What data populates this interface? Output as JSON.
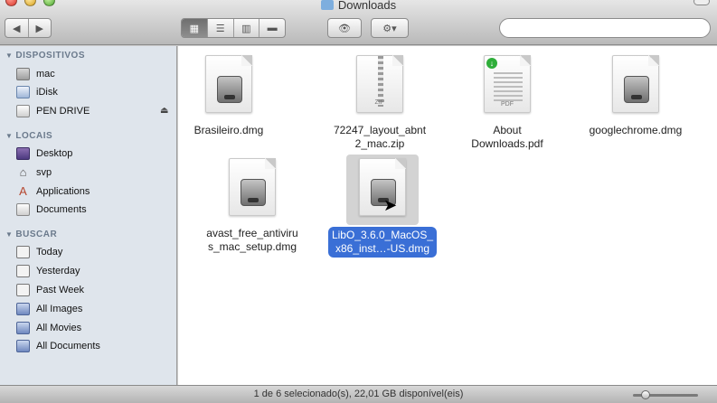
{
  "window": {
    "title": "Downloads"
  },
  "toolbar": {
    "back_glyph": "◀",
    "forward_glyph": "▶",
    "view_icon_glyph": "▦",
    "view_list_glyph": "☰",
    "view_column_glyph": "▥",
    "view_coverflow_glyph": "▬",
    "quicklook_glyph": "👁",
    "action_glyph": "⚙▾",
    "search_value": "",
    "search_glyph": "⌕"
  },
  "sidebar": {
    "devices_header": "DISPOSITIVOS",
    "places_header": "LOCAIS",
    "search_header": "BUSCAR",
    "devices": [
      {
        "label": "mac",
        "icon": "hard-disk-icon"
      },
      {
        "label": "iDisk",
        "icon": "idisk-icon"
      },
      {
        "label": "PEN DRIVE",
        "icon": "usb-drive-icon"
      }
    ],
    "eject_glyph": "⏏",
    "places": [
      {
        "label": "Desktop",
        "icon": "desktop-icon"
      },
      {
        "label": "svp",
        "icon": "home-icon",
        "glyph": "⌂"
      },
      {
        "label": "Applications",
        "icon": "applications-icon",
        "glyph": "A"
      },
      {
        "label": "Documents",
        "icon": "documents-icon"
      }
    ],
    "searches": [
      {
        "label": "Today",
        "icon": "clock-icon"
      },
      {
        "label": "Yesterday",
        "icon": "clock-icon"
      },
      {
        "label": "Past Week",
        "icon": "clock-icon"
      },
      {
        "label": "All Images",
        "icon": "smart-folder-icon"
      },
      {
        "label": "All Movies",
        "icon": "smart-folder-icon"
      },
      {
        "label": "All Documents",
        "icon": "smart-folder-icon"
      }
    ]
  },
  "files": [
    {
      "name": "Brasileiro.dmg",
      "kind": "dmg"
    },
    {
      "name": "72247_layout_abnt2_mac.zip",
      "kind": "zip",
      "badge": "ZIP"
    },
    {
      "name": "About Downloads.pdf",
      "kind": "pdf",
      "badge": "PDF"
    },
    {
      "name": "googlechrome.dmg",
      "kind": "dmg"
    },
    {
      "name": "avast_free_antivirus_mac_setup.dmg",
      "kind": "dmg"
    },
    {
      "name": "LibO_3.6.0_MacOS_x86_inst…-US.dmg",
      "kind": "dmg",
      "selected": true
    }
  ],
  "labels": {
    "brasileiro": "Brasileiro.dmg",
    "layout_line1": "72247_layout_abnt",
    "layout_line2": "2_mac.zip",
    "about_line1": "About",
    "about_line2": "Downloads.pdf",
    "chrome": "googlechrome.dmg",
    "avast_line1": "avast_free_antiviru",
    "avast_line2": "s_mac_setup.dmg",
    "libo_line1": "LibO_3.6.0_MacOS_",
    "libo_line2": "x86_inst…-US.dmg"
  },
  "status": {
    "text": "1 de 6 selecionado(s), 22,01 GB disponível(eis)",
    "icon_size_slider": 0.15
  },
  "colors": {
    "selection": "#3a6fd6",
    "sidebar_bg": "#dfe5ec",
    "sidebar_header": "#6b7a8c"
  }
}
